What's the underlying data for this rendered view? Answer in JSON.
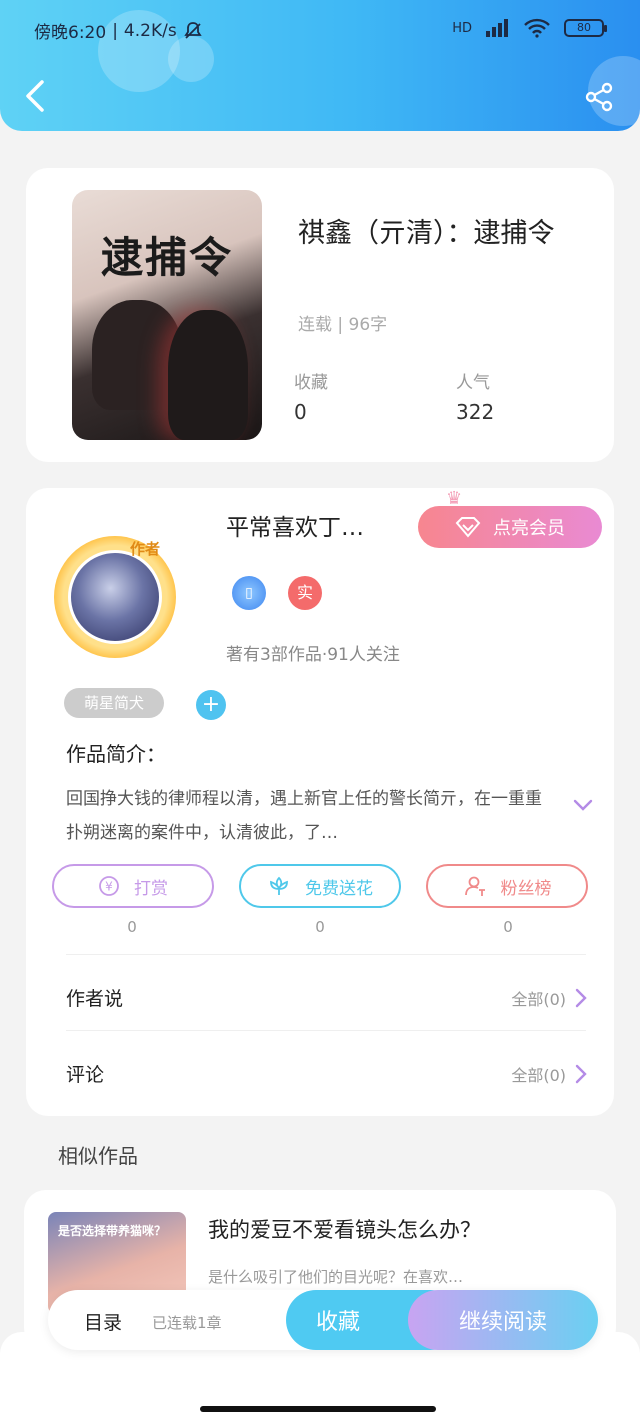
{
  "status_bar": {
    "time": "傍晚6:20",
    "speed": "4.2K/s",
    "network": "HD",
    "battery": "80"
  },
  "book": {
    "title": "祺鑫（亓清）：逮捕令",
    "cover_text": "逮捕令",
    "status": "连载",
    "word_count": "96字",
    "favorites_label": "收藏",
    "favorites_value": "0",
    "popularity_label": "人气",
    "popularity_value": "322"
  },
  "author": {
    "name": "平常喜欢丁…",
    "tag": "作者",
    "vip_label": "点亮会员",
    "badge_real": "实",
    "works": "著有3部作品·91人关注",
    "pill_tag": "萌星简犬",
    "add_tag": "+"
  },
  "intro": {
    "title": "作品简介：",
    "text": "回国挣大钱的律师程以清，遇上新官上任的警长简亓，在一重重扑朔迷离的案件中，认清彼此，了…"
  },
  "actions": [
    {
      "label": "打赏",
      "count": "0",
      "color": "#c69ae8"
    },
    {
      "label": "免费送花",
      "count": "0",
      "color": "#4fc8ea"
    },
    {
      "label": "粉丝榜",
      "count": "0",
      "color": "#f08a8a"
    }
  ],
  "rows": {
    "author_says": {
      "label": "作者说",
      "right": "全部(0)"
    },
    "comments": {
      "label": "评论",
      "right": "全部(0)"
    }
  },
  "similar": {
    "section_title": "相似作品",
    "thumb_text": "是否选择带养猫咪？",
    "title": "我的爱豆不爱看镜头怎么办？",
    "desc": "是什么吸引了他们的目光呢？在喜欢…"
  },
  "bottom_bar": {
    "toc": "目录",
    "toc_status": "已连载1章",
    "collect": "收藏",
    "read": "继续阅读"
  }
}
